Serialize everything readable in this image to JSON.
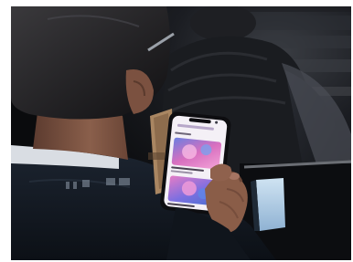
{
  "photo": {
    "subject": "person-using-smartphone",
    "colors": {
      "background": "#0d0e11",
      "jacket": "#141a22",
      "skin": "#7a5443",
      "hair": "#1c1a1c",
      "phone_screen": "#f4f0f6",
      "phone_case": "#a98662",
      "card_pink": "#d86fbf",
      "card_blue": "#4a6fd1"
    }
  },
  "phone_screen": {
    "header_text": "",
    "section_text": ""
  }
}
